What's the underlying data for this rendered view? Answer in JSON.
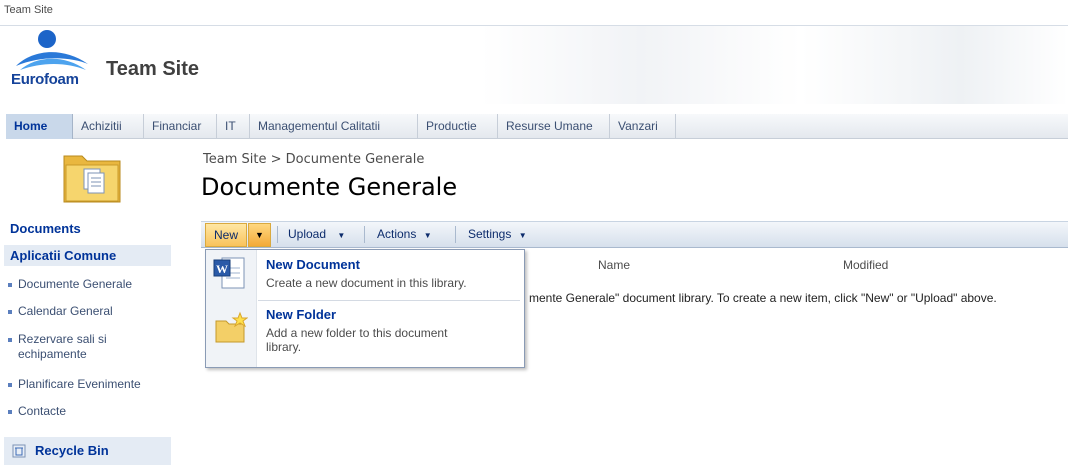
{
  "topbar": {
    "title": "Team Site"
  },
  "header": {
    "logo_text": "Eurofoam",
    "site_title": "Team Site"
  },
  "nav": {
    "items": [
      {
        "label": "Home"
      },
      {
        "label": "Achizitii"
      },
      {
        "label": "Financiar"
      },
      {
        "label": "IT"
      },
      {
        "label": "Managementul Calitatii"
      },
      {
        "label": "Productie"
      },
      {
        "label": "Resurse Umane"
      },
      {
        "label": "Vanzari"
      }
    ]
  },
  "quicklaunch": {
    "documents": "Documents",
    "section": "Aplicatii Comune",
    "items": [
      {
        "label": "Documente Generale"
      },
      {
        "label": "Calendar General"
      },
      {
        "label": "Rezervare sali si"
      },
      {
        "label": "echipamente"
      },
      {
        "label": "Planificare Evenimente"
      },
      {
        "label": "Contacte"
      }
    ],
    "recycle_bin": "Recycle Bin"
  },
  "main": {
    "breadcrumb": "Team Site > Documente Generale",
    "title": "Documente Generale",
    "toolbar": {
      "new": "New",
      "upload": "Upload",
      "actions": "Actions",
      "settings": "Settings"
    },
    "columns": {
      "name": "Name",
      "modified": "Modified"
    },
    "empty_message": "mente Generale\" document library. To create a new item, click \"New\" or \"Upload\" above."
  },
  "new_menu": {
    "items": [
      {
        "title": "New Document",
        "desc": [
          "Create a new document in this library."
        ]
      },
      {
        "title": "New Folder",
        "desc": [
          "Add a new folder to this document",
          "library."
        ]
      }
    ]
  },
  "colors": {
    "accent": "#003399",
    "nav_active": "#c9d8ea",
    "new_button": "#f9c35c"
  }
}
